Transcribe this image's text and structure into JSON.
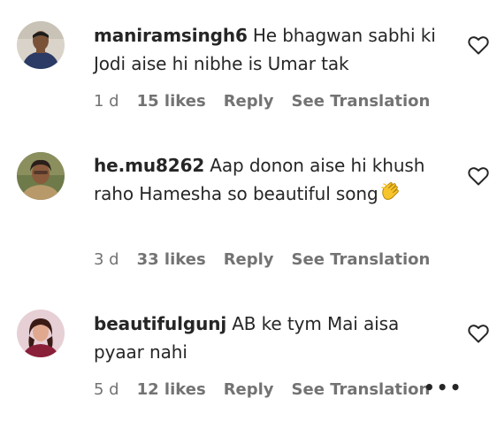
{
  "comments": [
    {
      "username": "maniramsingh6",
      "text": "He bhagwan sabhi ki Jodi aise hi nibhe is Umar tak",
      "time": "1 d",
      "likes": "15 likes",
      "reply": "Reply",
      "translate": "See Translation"
    },
    {
      "username": "he.mu8262",
      "text": "Aap donon aise hi khush raho Hamesha so beautiful song",
      "emoji": "clapping-hands",
      "time": "3 d",
      "likes": "33 likes",
      "reply": "Reply",
      "translate": "See Translation"
    },
    {
      "username": "beautifulgunj",
      "text": "AB ke tym Mai aisa pyaar nahi",
      "time": "5 d",
      "likes": "12 likes",
      "reply": "Reply",
      "translate": "See Translation",
      "more": "•••"
    }
  ],
  "colors": {
    "text": "#262626",
    "meta": "#737373",
    "background": "#ffffff"
  },
  "icons": [
    "heart-outline-icon",
    "more-options-icon",
    "clapping-hands-emoji"
  ]
}
